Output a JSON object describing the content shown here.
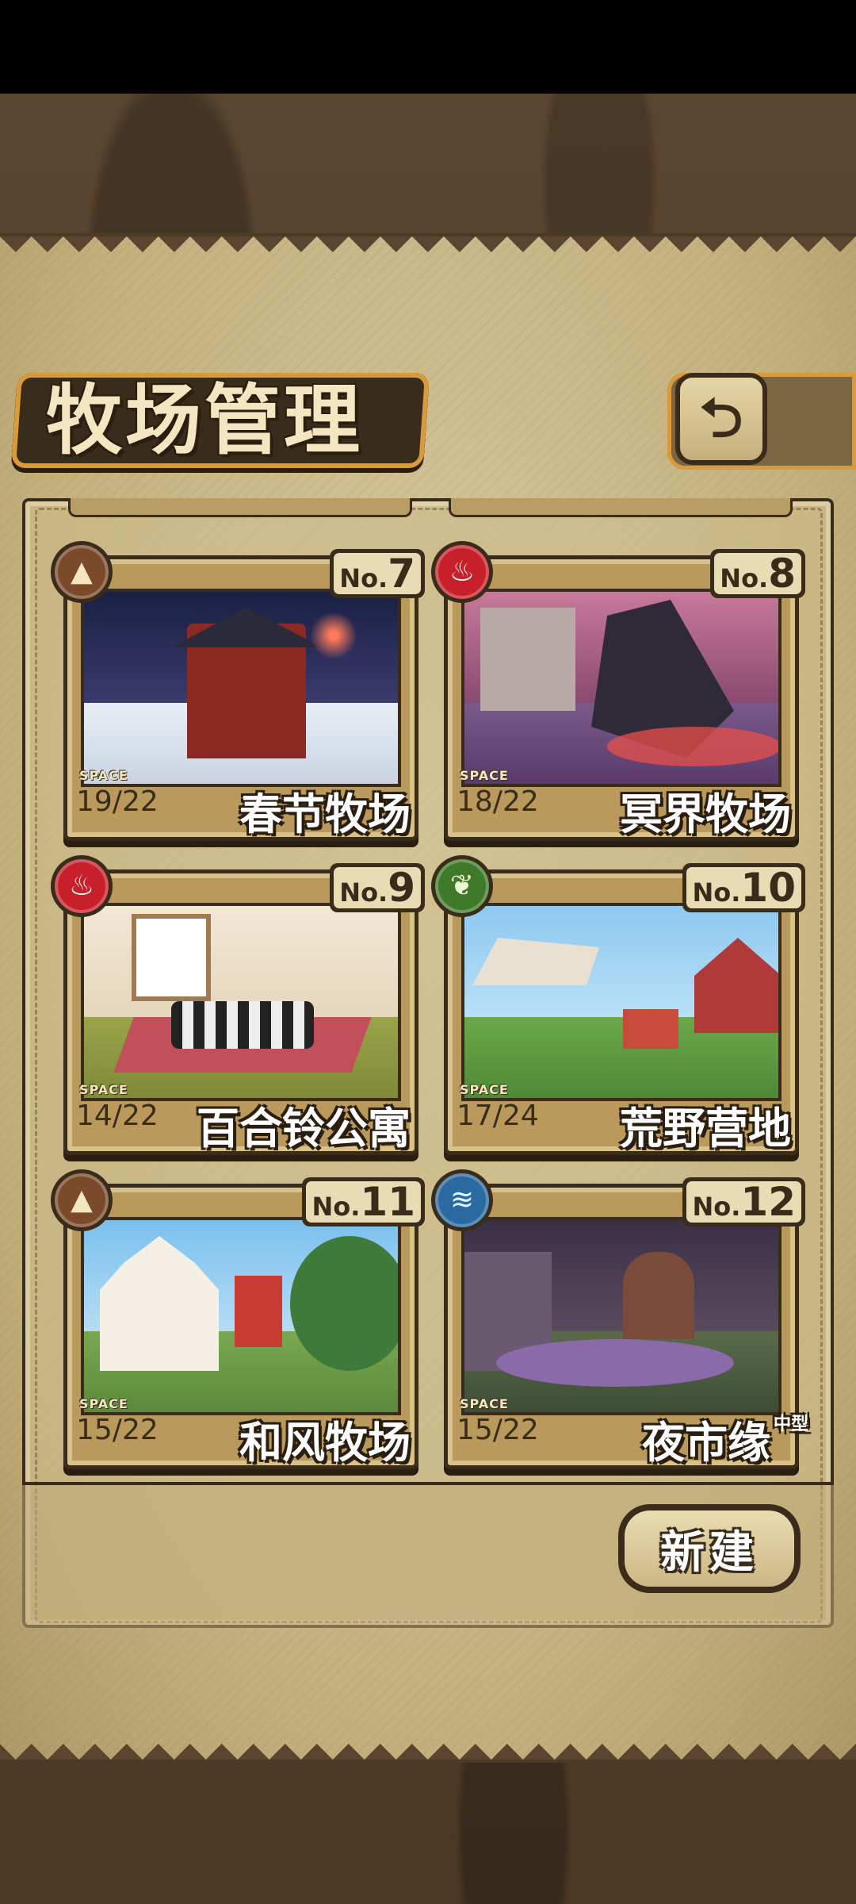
{
  "header": {
    "title": "牧场管理",
    "back_icon": "return-arrow-icon"
  },
  "space_label": "SPACE",
  "cards": [
    {
      "no_prefix": "No.",
      "no": "7",
      "name": "春节牧场",
      "space": "19/22",
      "type_icon": "mountain-icon",
      "type_color": "#7a4a2a"
    },
    {
      "no_prefix": "No.",
      "no": "8",
      "name": "冥界牧场",
      "space": "18/22",
      "type_icon": "fire-icon",
      "type_color": "#c8202a"
    },
    {
      "no_prefix": "No.",
      "no": "9",
      "name": "百合铃公寓",
      "space": "14/22",
      "type_icon": "fire-icon",
      "type_color": "#c8202a"
    },
    {
      "no_prefix": "No.",
      "no": "10",
      "name": "荒野营地",
      "space": "17/24",
      "type_icon": "leaf-icon",
      "type_color": "#3f7a2a"
    },
    {
      "no_prefix": "No.",
      "no": "11",
      "name": "和风牧场",
      "space": "15/22",
      "type_icon": "mountain-icon",
      "type_color": "#7a4a2a"
    },
    {
      "no_prefix": "No.",
      "no": "12",
      "name": "夜市缘",
      "size_tag": "中型",
      "space": "15/22",
      "type_icon": "water-icon",
      "type_color": "#2a6aa0"
    }
  ],
  "footer": {
    "new_label": "新建"
  }
}
